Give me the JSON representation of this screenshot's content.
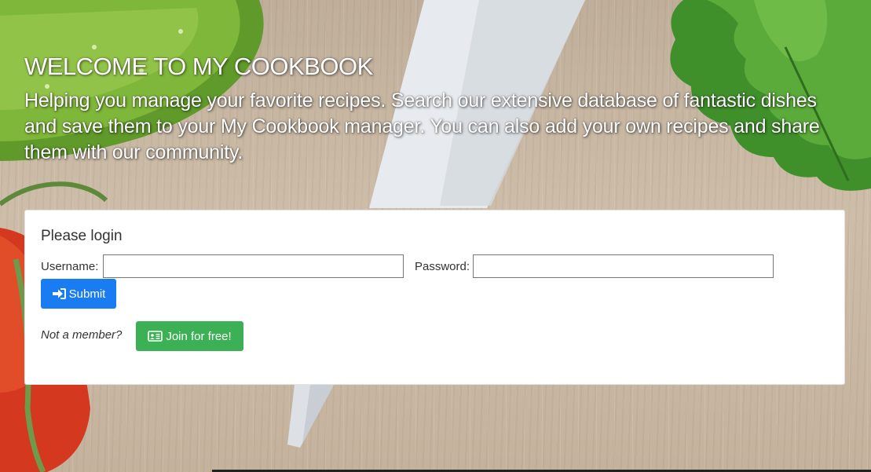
{
  "hero": {
    "title": "WELCOME TO MY COOKBOOK",
    "description": "Helping you manage your favorite recipes. Search our extensive database of fantastic dishes and save them to your My Cookbook manager. You can also add your own recipes and share them with our community."
  },
  "login": {
    "heading": "Please login",
    "username_label": "Username:",
    "username_value": "",
    "password_label": "Password:",
    "password_value": "",
    "submit_label": "Submit",
    "not_member_text": "Not a member?",
    "join_label": "Join for free!"
  },
  "icons": {
    "submit": "sign-in-icon",
    "join": "id-card-icon"
  },
  "colors": {
    "primary_button": "#1a7cf3",
    "success_button": "#3cb054",
    "hero_text": "#ffffff"
  }
}
